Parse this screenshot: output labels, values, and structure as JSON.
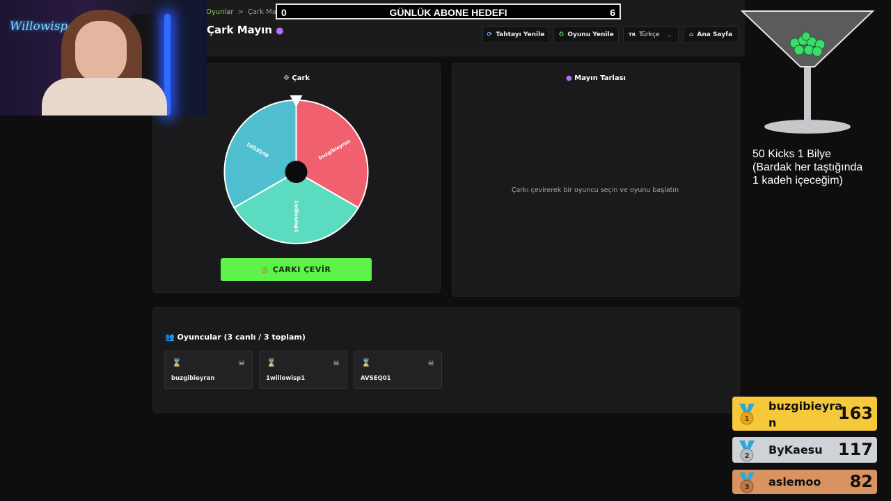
{
  "breadcrumb": {
    "parent": "Oyunlar",
    "separator": ">",
    "current": "Çark Mayın"
  },
  "page_title": "Çark Mayın",
  "page_title_icon": "bomb-icon",
  "goal_bar": {
    "left": "0",
    "title": "GÜNLÜK ABONE HEDEFI",
    "right": "6"
  },
  "toolbar": {
    "refresh_board": "Tahtayı Yenile",
    "new_game": "Oyunu Yenile",
    "lang_flag": "TR",
    "language": "Türkçe",
    "home": "Ana Sayfa"
  },
  "wheel_panel": {
    "title": "Çark",
    "spin_button": "ÇARKI ÇEVİR"
  },
  "wheel": {
    "segments": [
      {
        "label": "buzgibieyran",
        "color": "#f0606e"
      },
      {
        "label": "1willowisp1",
        "color": "#5bdcc0"
      },
      {
        "label": "AVSEQ01",
        "color": "#4fbfd0"
      }
    ]
  },
  "mine_panel": {
    "title": "Mayın Tarlası",
    "hint": "Çarkı çevirerek bir oyuncu seçin ve oyunu başlatın"
  },
  "players": {
    "title": "Oyuncular (3 canlı / 3 toplam)",
    "list": [
      {
        "name": "buzgibieyran"
      },
      {
        "name": "1willowisp1"
      },
      {
        "name": "AVSEQ01"
      }
    ]
  },
  "webcam": {
    "logo_text": "Willowisp"
  },
  "overlay": {
    "glass_text_1": "50 Kicks 1 Bilye",
    "glass_text_2": "(Bardak her taştığında",
    "glass_text_3": "1 kadeh içeceğim)"
  },
  "leaderboard": [
    {
      "rank": "1",
      "name_line1": "buzgibieyra",
      "name_line2": "n",
      "score": "163",
      "color": "#f6c93a"
    },
    {
      "rank": "2",
      "name_line1": "ByKaesu",
      "name_line2": "",
      "score": "117",
      "color": "#cfd3d8"
    },
    {
      "rank": "3",
      "name_line1": "aslemoo",
      "name_line2": "",
      "score": "82",
      "color": "#d99360"
    }
  ]
}
